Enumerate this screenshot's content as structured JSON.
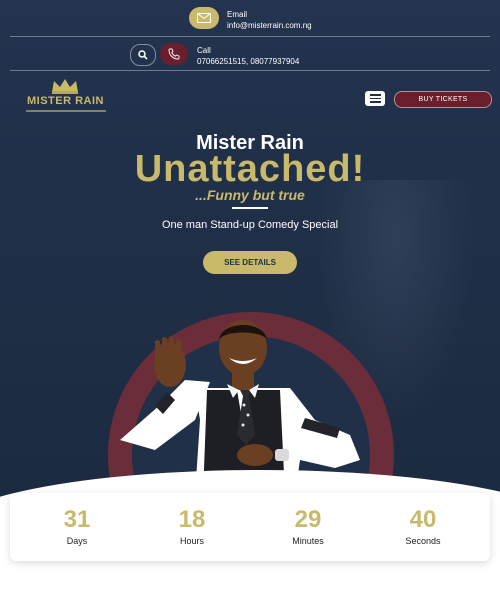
{
  "topbar": {
    "email_label": "Email",
    "email_value": "info@misterrain.com.ng",
    "call_label": "Call",
    "call_value": "07066251515, 08077937904"
  },
  "nav": {
    "logo_text": "MISTER RAIN",
    "buy_tickets": "BUY TICKETS"
  },
  "hero": {
    "title_small": "Mister Rain",
    "title_big": "Unattached!",
    "tagline": "...Funny but true",
    "subtitle": "One man Stand-up Comedy Special",
    "cta": "SEE DETAILS"
  },
  "countdown": [
    {
      "value": "31",
      "label": "Days"
    },
    {
      "value": "18",
      "label": "Hours"
    },
    {
      "value": "29",
      "label": "Minutes"
    },
    {
      "value": "40",
      "label": "Seconds"
    }
  ],
  "colors": {
    "accent_gold": "#c9b96a",
    "brand_maroon": "#6b1e2b",
    "hero_bg": "#203049"
  },
  "icons": [
    "envelope-icon",
    "search-icon",
    "phone-icon",
    "crown-icon",
    "hamburger-menu-icon"
  ]
}
